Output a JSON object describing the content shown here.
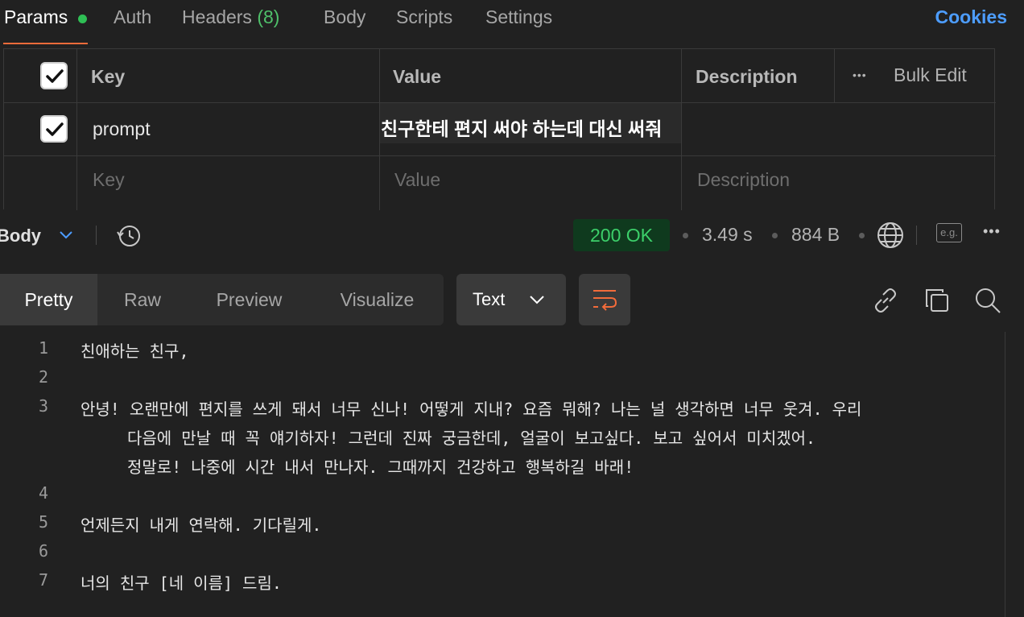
{
  "request_tabs": {
    "params": "Params",
    "auth": "Auth",
    "headers": "Headers",
    "headers_count": "(8)",
    "body": "Body",
    "scripts": "Scripts",
    "settings": "Settings",
    "cookies": "Cookies"
  },
  "params_table": {
    "headers": {
      "key": "Key",
      "value": "Value",
      "description": "Description",
      "bulk_edit": "Bulk Edit"
    },
    "rows": [
      {
        "key": "prompt",
        "value": "친구한테 편지 써야 하는데 대신 써줘",
        "checked": true
      }
    ],
    "placeholders": {
      "key": "Key",
      "value": "Value",
      "description": "Description"
    }
  },
  "response": {
    "body_label": "Body",
    "status": "200 OK",
    "time": "3.49 s",
    "size": "884 B",
    "example_label": "e.g."
  },
  "view_tabs": {
    "pretty": "Pretty",
    "raw": "Raw",
    "preview": "Preview",
    "visualize": "Visualize",
    "format": "Text"
  },
  "code_lines": [
    {
      "n": "1",
      "text": "친애하는 친구,"
    },
    {
      "n": "2",
      "text": ""
    },
    {
      "n": "3",
      "text": "안녕! 오랜만에 편지를 쓰게 돼서 너무 신나! 어떻게 지내? 요즘 뭐해? 나는 널 생각하면 너무 웃겨. 우리"
    },
    {
      "n": "",
      "text": "다음에 만날 때 꼭 얘기하자! 그런데 진짜 궁금한데, 얼굴이 보고싶다. 보고 싶어서 미치겠어."
    },
    {
      "n": "",
      "text": "정말로! 나중에 시간 내서 만나자. 그때까지 건강하고 행복하길 바래!"
    },
    {
      "n": "4",
      "text": ""
    },
    {
      "n": "5",
      "text": "언제든지 내게 연락해. 기다릴게."
    },
    {
      "n": "6",
      "text": ""
    },
    {
      "n": "7",
      "text": "너의 친구 [네 이름] 드림."
    }
  ],
  "colors": {
    "background": "#212121",
    "accent_orange": "#f26b3a",
    "status_green": "#3ccf6a",
    "link_blue": "#4d9dff"
  }
}
